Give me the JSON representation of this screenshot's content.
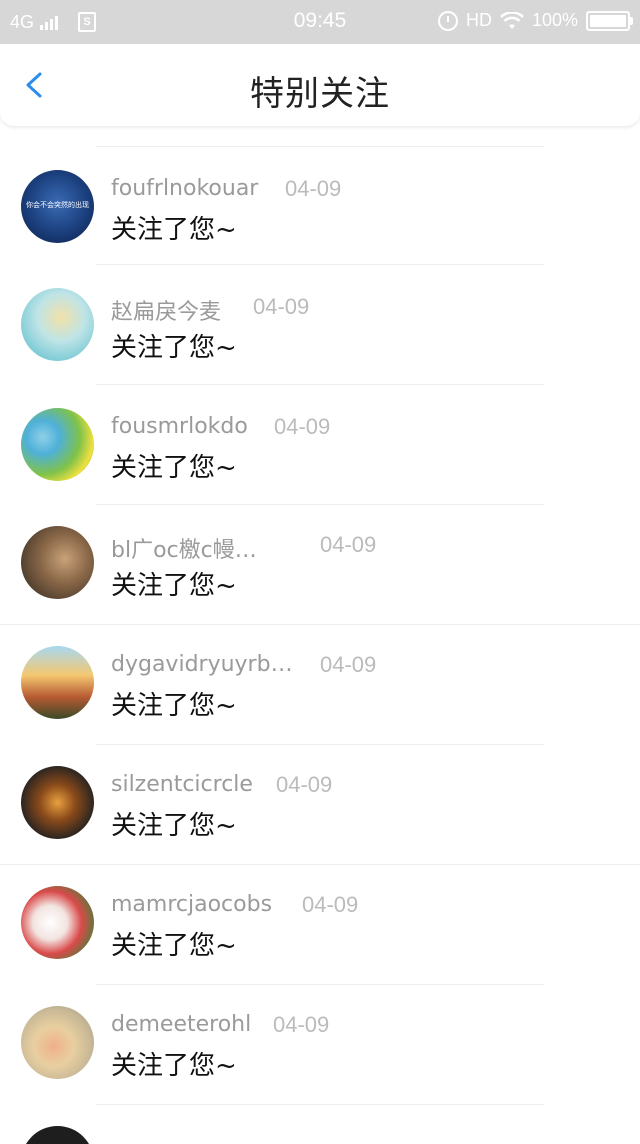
{
  "status_bar": {
    "network": "4G",
    "time": "09:45",
    "hd": "HD",
    "battery": "100%"
  },
  "nav": {
    "title": "特别关注"
  },
  "items": [
    {
      "name": "foufrlnokouar",
      "date": "04-09",
      "message": "关注了您~",
      "avatar_text": "你会不会突然的出现"
    },
    {
      "name": "赵扁戾今麦",
      "date": "04-09",
      "message": "关注了您~"
    },
    {
      "name": "fousmrlokdo",
      "date": "04-09",
      "message": "关注了您~"
    },
    {
      "name": "bl广oc檄c幔…",
      "date": "04-09",
      "message": "关注了您~"
    },
    {
      "name": "dygavidryuyrb…",
      "date": "04-09",
      "message": "关注了您~"
    },
    {
      "name": "silzentcicrcle",
      "date": "04-09",
      "message": "关注了您~"
    },
    {
      "name": "mamrcjaocobs",
      "date": "04-09",
      "message": "关注了您~"
    },
    {
      "name": "demeeterohl",
      "date": "04-09",
      "message": "关注了您~"
    }
  ]
}
